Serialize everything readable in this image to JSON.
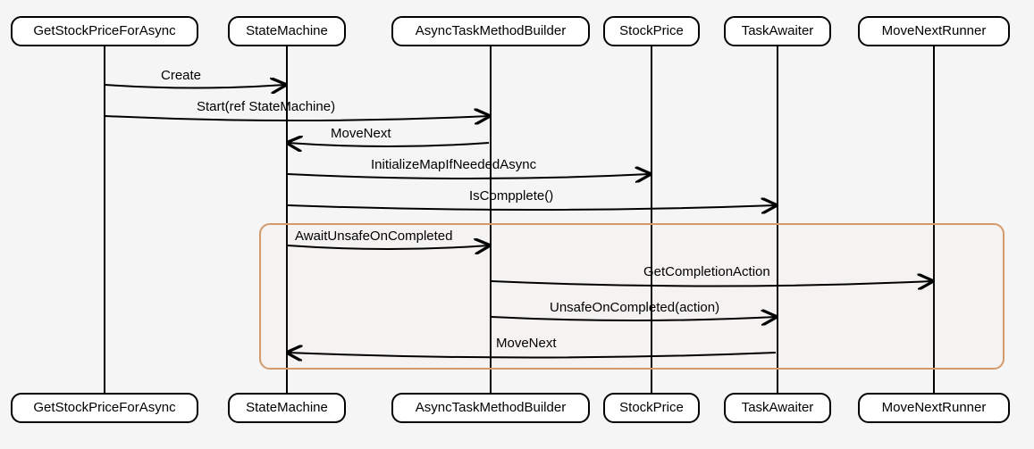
{
  "chart_data": {
    "type": "sequence-diagram",
    "participants": [
      "GetStockPriceForAsync",
      "StateMachine",
      "AsyncTaskMethodBuilder",
      "StockPrice",
      "TaskAwaiter",
      "MoveNextRunner"
    ],
    "messages": [
      {
        "from": "GetStockPriceForAsync",
        "to": "StateMachine",
        "label": "Create"
      },
      {
        "from": "GetStockPriceForAsync",
        "to": "AsyncTaskMethodBuilder",
        "label": "Start(ref StateMachine)"
      },
      {
        "from": "AsyncTaskMethodBuilder",
        "to": "StateMachine",
        "label": "MoveNext"
      },
      {
        "from": "StateMachine",
        "to": "StockPrice",
        "label": "InitializeMapIfNeededAsync"
      },
      {
        "from": "StateMachine",
        "to": "TaskAwaiter",
        "label": "IsCompplete()"
      },
      {
        "from": "StateMachine",
        "to": "AsyncTaskMethodBuilder",
        "label": "AwaitUnsafeOnCompleted"
      },
      {
        "from": "AsyncTaskMethodBuilder",
        "to": "MoveNextRunner",
        "label": "GetCompletionAction"
      },
      {
        "from": "AsyncTaskMethodBuilder",
        "to": "TaskAwaiter",
        "label": "UnsafeOnCompleted(action)"
      },
      {
        "from": "TaskAwaiter",
        "to": "StateMachine",
        "label": "MoveNext"
      }
    ],
    "highlight_group": {
      "messages": [
        "AwaitUnsafeOnCompleted",
        "GetCompletionAction",
        "UnsafeOnCompleted(action)",
        "MoveNext"
      ]
    }
  },
  "p": {
    "a": "GetStockPriceForAsync",
    "b": "StateMachine",
    "c": "AsyncTaskMethodBuilder",
    "d": "StockPrice",
    "e": "TaskAwaiter",
    "f": "MoveNextRunner"
  },
  "m": {
    "create": "Create",
    "start": "Start(ref StateMachine)",
    "mn1": "MoveNext",
    "init": "InitializeMapIfNeededAsync",
    "isc": "IsCompplete()",
    "auoc": "AwaitUnsafeOnCompleted",
    "gca": "GetCompletionAction",
    "uoc": "UnsafeOnCompleted(action)",
    "mn2": "MoveNext"
  }
}
